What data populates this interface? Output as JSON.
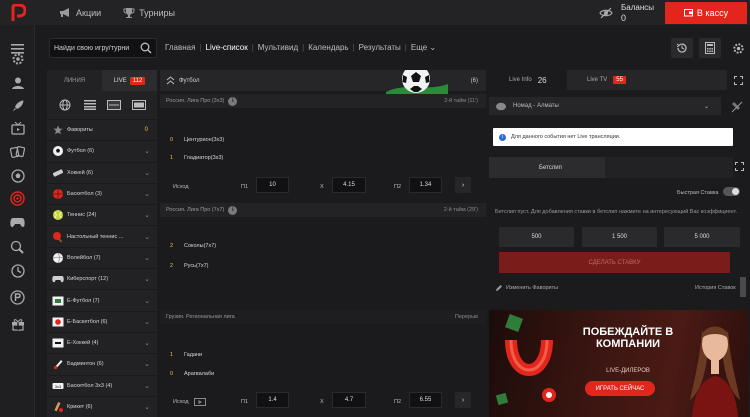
{
  "header": {
    "promo_label": "Акции",
    "tournaments_label": "Турниры",
    "balance_label": "Балансы",
    "balance_value": "0",
    "cashier_label": "В кассу"
  },
  "search": {
    "placeholder": "Найди свою игру/турни"
  },
  "nav": {
    "items": [
      "Главная",
      "Live-список",
      "Мультивид",
      "Календарь",
      "Результаты",
      "Еще"
    ]
  },
  "sports_panel": {
    "tab_line": "ЛИНИЯ",
    "tab_live": "LIVE",
    "live_count": "112",
    "favorites": {
      "label": "Фавориты",
      "count": "0"
    },
    "sports": [
      {
        "name": "Футбол (6)",
        "icon": "soccer-ball-icon"
      },
      {
        "name": "Хоккей (6)",
        "icon": "hockey-icon"
      },
      {
        "name": "Баскетбол (3)",
        "icon": "basketball-icon"
      },
      {
        "name": "Теннис (24)",
        "icon": "tennis-icon"
      },
      {
        "name": "Настольный теннис ...",
        "icon": "table-tennis-icon"
      },
      {
        "name": "Волейбол (7)",
        "icon": "volleyball-icon"
      },
      {
        "name": "Киберспорт (12)",
        "icon": "esports-icon"
      },
      {
        "name": "Е-Футбол (7)",
        "icon": "efootball-icon"
      },
      {
        "name": "Е-Баскетбол (6)",
        "icon": "ebasketball-icon"
      },
      {
        "name": "Е-Хоккей (4)",
        "icon": "ehockey-icon"
      },
      {
        "name": "Бадминтон (6)",
        "icon": "badminton-icon"
      },
      {
        "name": "Баскетбол 3х3 (4)",
        "icon": "basketball-3x3-icon"
      },
      {
        "name": "Крикет (6)",
        "icon": "cricket-icon"
      }
    ]
  },
  "events": {
    "sport_title": "Футбол",
    "sport_count": "(6)",
    "leagues": [
      {
        "name": "Россия. Лига Про (3х3)",
        "status": "2-й тайм (11')",
        "teams": [
          {
            "score": "0",
            "name": "Центурион(3х3)"
          },
          {
            "score": "1",
            "name": "Гладиатор(3х3)"
          }
        ],
        "market": "Исход",
        "odds": [
          {
            "label": "П1",
            "value": "10"
          },
          {
            "label": "Х",
            "value": "4.15"
          },
          {
            "label": "П2",
            "value": "1.34"
          }
        ]
      },
      {
        "name": "Россия. Лига Про (7х7)",
        "status": "2-й тайм (29')",
        "teams": [
          {
            "score": "2",
            "name": "Соколы(7х7)"
          },
          {
            "score": "2",
            "name": "Русь(7х7)"
          }
        ]
      },
      {
        "name": "Грузия. Региональная лига",
        "status": "Перерыв",
        "teams": [
          {
            "score": "1",
            "name": "Гадани"
          },
          {
            "score": "0",
            "name": "Арагвалаби"
          }
        ],
        "market": "Исход",
        "odds": [
          {
            "label": "П1",
            "value": "1.4"
          },
          {
            "label": "Х",
            "value": "4.7"
          },
          {
            "label": "П2",
            "value": "6.55"
          }
        ]
      }
    ]
  },
  "right_panel": {
    "live_info_label": "Live Info",
    "live_info_count": "26",
    "live_tv_label": "Live TV",
    "live_tv_count": "55",
    "match_select": "Номад - Алматы",
    "no_broadcast": "Для данного события нет Live трансляции.",
    "betslip_tab": "Бетслип",
    "quick_stake": "Быстрая Ставка",
    "betslip_hint": "Бетслип пуст. Для добавления ставки в бетслип нажмите на интересующий Вас коэффициент.",
    "stakes": [
      "500",
      "1 500",
      "5 000"
    ],
    "place_bet": "СДЕЛАТЬ СТАВКУ",
    "change_favs": "Изменить Фавориты",
    "history": "История Ставок"
  },
  "promo": {
    "title": "ПОБЕЖДАЙТЕ В КОМПАНИИ",
    "subtitle": "LIVE-ДИЛЕРОВ",
    "cta": "ИГРАТЬ СЕЙЧАС"
  },
  "colors": {
    "accent": "#e3261c",
    "score": "#e9c546"
  }
}
